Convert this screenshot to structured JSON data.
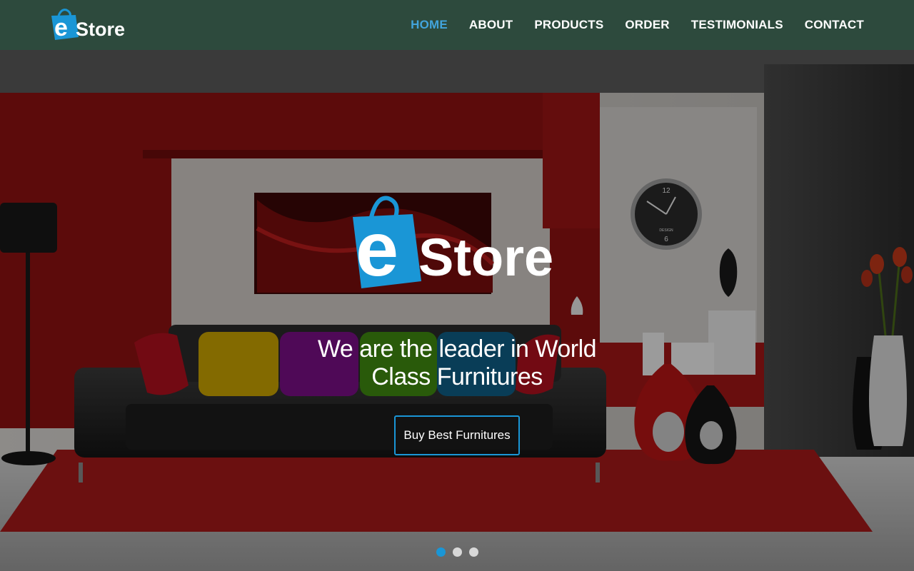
{
  "brand": {
    "logo_letter": "e",
    "logo_word": "Store",
    "brand_color": "#1a96d6"
  },
  "nav": {
    "items": [
      {
        "label": "HOME",
        "active": true
      },
      {
        "label": "ABOUT",
        "active": false
      },
      {
        "label": "PRODUCTS",
        "active": false
      },
      {
        "label": "ORDER",
        "active": false
      },
      {
        "label": "TESTIMONIALS",
        "active": false
      },
      {
        "label": "CONTACT",
        "active": false
      }
    ],
    "background": "#2d4a3d",
    "active_color": "#42a4dc"
  },
  "hero": {
    "tagline_line1": "We are the leader in World",
    "tagline_line2": "Class Furnitures",
    "cta_label": "Buy Best Furnitures",
    "clock_number_top": "12",
    "clock_number_bottom": "6",
    "clock_brand": "DESIGN",
    "slides": {
      "count": 3,
      "active": 1
    }
  }
}
